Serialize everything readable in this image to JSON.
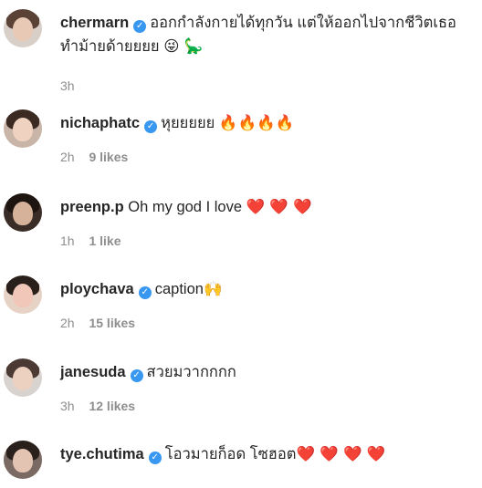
{
  "comments": [
    {
      "username": "chermarn",
      "verified": true,
      "text": "ออกกำลังกายได้ทุกวัน แต่ให้ออกไปจากชีวิตเธอ",
      "text2": "ทำม้ายด้ายยยย",
      "emojis2": "😜 🦕",
      "time": "3h",
      "likes": ""
    },
    {
      "username": "nichaphatc",
      "verified": true,
      "text": "หุยยยยย",
      "emojis": "🔥🔥🔥🔥",
      "time": "2h",
      "likes": "9 likes"
    },
    {
      "username": "preenp.p",
      "verified": false,
      "text": "Oh my god I love",
      "emojis": "❤️ ❤️ ❤️",
      "time": "1h",
      "likes": "1 like"
    },
    {
      "username": "ploychava",
      "verified": true,
      "text": "caption",
      "emojis": "🙌",
      "time": "2h",
      "likes": "15 likes"
    },
    {
      "username": "janesuda",
      "verified": true,
      "text": "สวยมวากกกก",
      "emojis": "",
      "time": "3h",
      "likes": "12 likes"
    },
    {
      "username": "tye.chutima",
      "verified": true,
      "text": "โอวมายก็อด โซฮอต",
      "emojis": "❤️ ❤️ ❤️ ❤️",
      "time": "",
      "likes": ""
    }
  ]
}
